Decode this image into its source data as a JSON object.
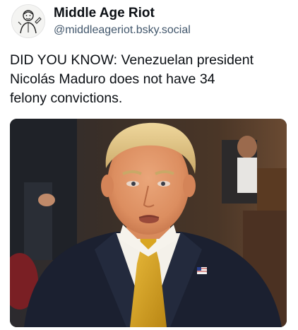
{
  "author": {
    "display_name": "Middle Age Riot",
    "handle": "@middleageriot.bsky.social",
    "avatar_icon": "sketch-portrait-avatar-icon"
  },
  "post": {
    "text_lines": [
      "DID YOU KNOW: Venezuelan president",
      "Nicolás Maduro does not have 34",
      "felony convictions."
    ]
  },
  "media": {
    "type": "photo",
    "subject": "man-in-suit-courtroom-photo",
    "colors": {
      "suit": "#1d2233",
      "tie": "#d9a521",
      "shirt": "#f4f1ea",
      "hair": "#e0c585",
      "skin": "#e49a6f",
      "background": "#3a2c22"
    }
  }
}
